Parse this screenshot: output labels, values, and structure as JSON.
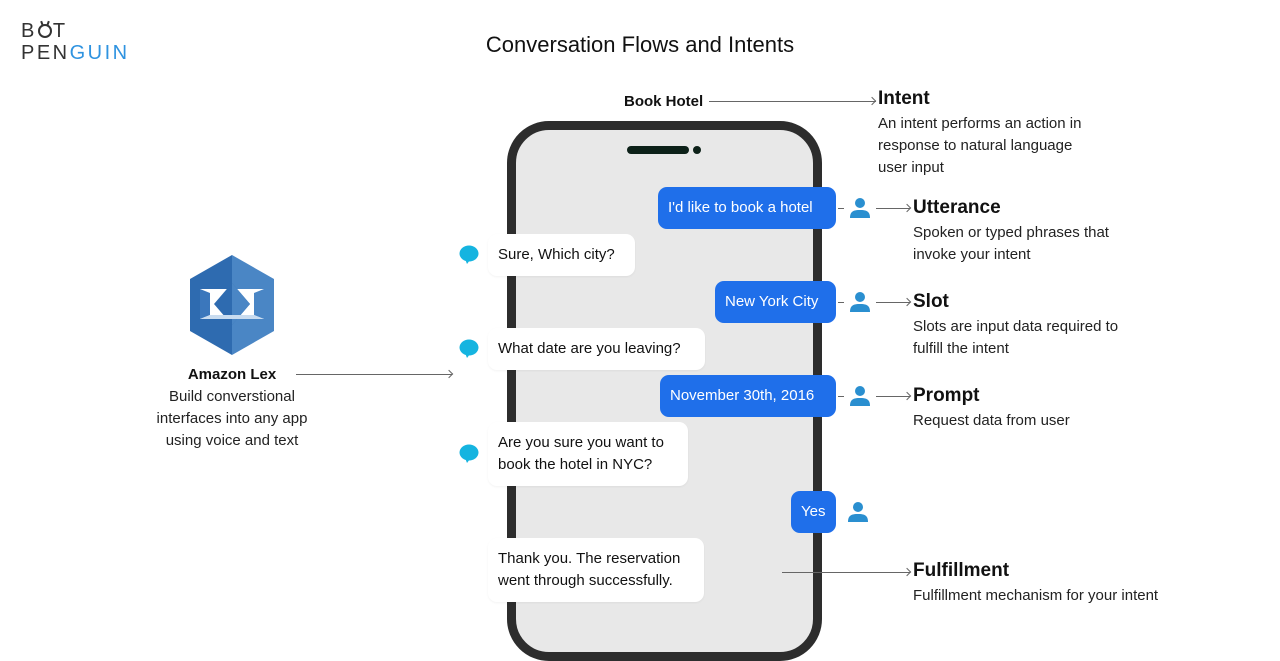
{
  "logo": {
    "line1_prefix": "B",
    "line1_suffix": "T",
    "line2_dark": "PEN",
    "line2_blue": "GUIN"
  },
  "title": "Conversation Flows and Intents",
  "phone_header": "Book Hotel",
  "colors": {
    "user_bubble": "#1f6fea",
    "bot_icon": "#15b4e0",
    "user_icon": "#2a8fd0",
    "logo_accent": "#2f93e0",
    "lex_blue": "#2e6bb0"
  },
  "messages": [
    {
      "sender": "user",
      "text": "I'd like to book a hotel"
    },
    {
      "sender": "bot",
      "text": "Sure, Which city?"
    },
    {
      "sender": "user",
      "text": "New York City"
    },
    {
      "sender": "bot",
      "text": "What date are you leaving?"
    },
    {
      "sender": "user",
      "text": "November 30th, 2016"
    },
    {
      "sender": "bot",
      "lines": [
        "Are you sure you want to",
        "book the hotel in NYC?"
      ]
    },
    {
      "sender": "user",
      "text": "Yes"
    },
    {
      "sender": "bot",
      "lines": [
        "Thank you. The reservation",
        "went through successfully."
      ]
    }
  ],
  "annotations": {
    "intent": {
      "title": "Intent",
      "desc": [
        "An intent performs an action in",
        "response to natural language",
        "user input"
      ]
    },
    "utterance": {
      "title": "Utterance",
      "desc": [
        "Spoken or typed phrases that",
        "invoke your intent"
      ]
    },
    "slot": {
      "title": "Slot",
      "desc": [
        "Slots are input data required to",
        "fulfill the intent"
      ]
    },
    "prompt": {
      "title": "Prompt",
      "desc": [
        "Request data from user"
      ]
    },
    "fulfillment": {
      "title": "Fulfillment",
      "desc": [
        "Fulfillment mechanism for your intent"
      ]
    }
  },
  "lex": {
    "icon": "amazon-lex-icon",
    "title": "Amazon Lex",
    "desc": [
      "Build converstional",
      "interfaces into any app",
      "using voice and text"
    ]
  }
}
